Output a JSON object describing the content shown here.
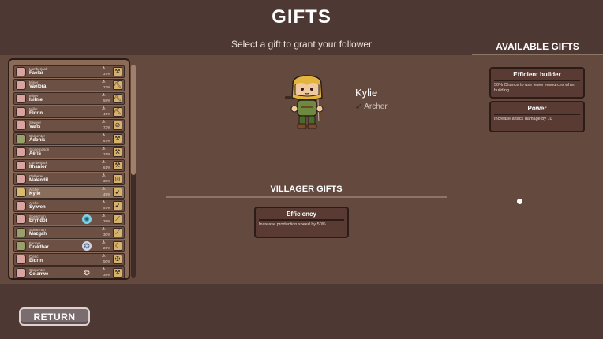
{
  "header": {
    "title": "GIFTS",
    "subtitle": "Select a gift to grant your follower"
  },
  "available_gifts": {
    "title": "AVAILABLE GIFTS",
    "items": [
      {
        "name": "Efficient builder",
        "description": "50% Chance to use fewer resources when building."
      },
      {
        "name": "Power",
        "description": "Increase attack damage by 10"
      }
    ]
  },
  "follower": {
    "name": "Kylie",
    "class": "Archer",
    "class_icon": "bow-icon"
  },
  "villager_gifts": {
    "title": "VILLAGER GIFTS",
    "items": [
      {
        "name": "Efficiency",
        "description": "Increase production speed by 50%"
      }
    ]
  },
  "followers": [
    {
      "job": "Lumberjack",
      "name": "Faelar",
      "pct": "37%",
      "badge": "",
      "tool": "axe-icon",
      "avatar": "pink"
    },
    {
      "job": "Miner",
      "name": "Vaelora",
      "pct": "27%",
      "badge": "",
      "tool": "pickaxe-icon",
      "avatar": "pink"
    },
    {
      "job": "Miner",
      "name": "Isilme",
      "pct": "58%",
      "badge": "",
      "tool": "pickaxe-icon",
      "avatar": "pink"
    },
    {
      "job": "Miller",
      "name": "Eldrin",
      "pct": "46%",
      "badge": "",
      "tool": "pickaxe-icon",
      "avatar": "pink"
    },
    {
      "job": "Sawyer",
      "name": "Varis",
      "pct": "73%",
      "badge": "",
      "tool": "saw-icon",
      "avatar": "pink"
    },
    {
      "job": "Carpenter",
      "name": "Adonis",
      "pct": "67%",
      "badge": "",
      "tool": "hammer-icon",
      "avatar": "green"
    },
    {
      "job": "Stonemason",
      "name": "Aeris",
      "pct": "31%",
      "badge": "",
      "tool": "hammer-icon",
      "avatar": "pink"
    },
    {
      "job": "Lumberjack",
      "name": "Ithanion",
      "pct": "61%",
      "badge": "",
      "tool": "axe-icon",
      "avatar": "pink"
    },
    {
      "job": "Gatherer",
      "name": "Malendil",
      "pct": "38%",
      "badge": "",
      "tool": "basket-icon",
      "avatar": "pink"
    },
    {
      "job": "Archer",
      "name": "Kylie",
      "pct": "48%",
      "badge": "",
      "tool": "bow-icon",
      "avatar": "gold",
      "selected": true
    },
    {
      "job": "Archer",
      "name": "Sylwen",
      "pct": "57%",
      "badge": "",
      "tool": "bow-icon",
      "avatar": "pink"
    },
    {
      "job": "Spearman",
      "name": "Eryndor",
      "pct": "38%",
      "badge": "✺",
      "badge_style": "blue",
      "tool": "spear-icon",
      "avatar": "pink"
    },
    {
      "job": "Spearman",
      "name": "Mazgah",
      "pct": "30%",
      "badge": "",
      "tool": "spear-icon",
      "avatar": "green"
    },
    {
      "job": "Farmer",
      "name": "Drakthar",
      "pct": "20%",
      "badge": "❂",
      "badge_style": "gray",
      "tool": "scythe-icon",
      "avatar": "green"
    },
    {
      "job": "Cleric",
      "name": "Eldrin",
      "pct": "50%",
      "badge": "",
      "tool": "staff-icon",
      "avatar": "pink"
    },
    {
      "job": "Carpenter",
      "name": "Celanwe",
      "pct": "38%",
      "badge": "❂",
      "badge_style": "plain",
      "tool": "hammer-icon",
      "avatar": "pink"
    },
    {
      "job": "Gatherer",
      "name": "",
      "pct": "",
      "badge": "",
      "tool": "basket-icon",
      "avatar": "gold"
    }
  ],
  "footer": {
    "return_label": "RETURN"
  },
  "colors": {
    "background": "#4e3834",
    "panel": "#64493e",
    "card": "#593b34",
    "list_frame": "#8c6a58"
  }
}
